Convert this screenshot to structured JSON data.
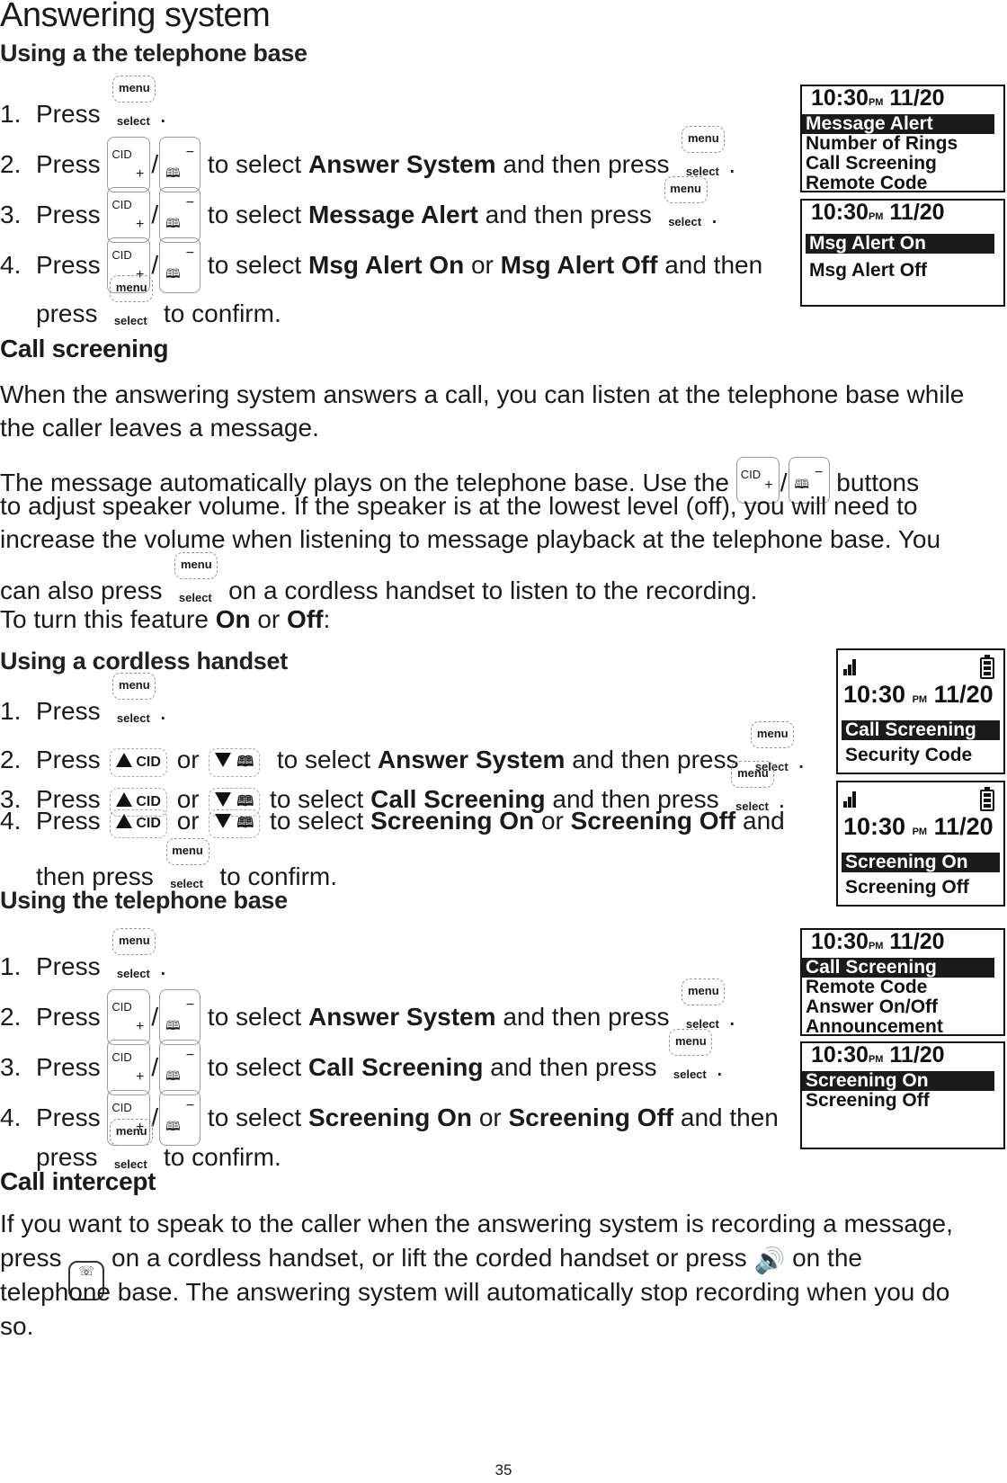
{
  "page": {
    "title": "Answering system",
    "page_number": "35"
  },
  "icons": {
    "menu_top": "menu",
    "menu_bottom": "select",
    "cid": "CID",
    "plus": "+",
    "minus": "−",
    "book": "🕮",
    "slash": "/",
    "or": "or",
    "talk": "☏",
    "speaker": "🔊"
  },
  "section1": {
    "heading": "Using a the telephone base",
    "steps": [
      {
        "num": "1.",
        "pre": "Press",
        "post": "."
      },
      {
        "num": "2.",
        "pre": "Press",
        "mid": "to select",
        "bold": "Answer System",
        "post": "and then press",
        "end": "."
      },
      {
        "num": "3.",
        "pre": "Press",
        "mid": "to select",
        "bold": "Message Alert",
        "post": "and then press",
        "end": "."
      },
      {
        "num": "4.",
        "pre": "Press",
        "mid": "to select",
        "bold": "Msg Alert On",
        "or": "or",
        "bold2": "Msg Alert Off",
        "post": "and then",
        "cont_pre": "press",
        "cont_post": "to confirm."
      }
    ],
    "screens": [
      {
        "time": "10:30",
        "ampm": "PM",
        "date": "11/20",
        "items": [
          "Message Alert",
          "Number of Rings",
          "Call Screening",
          "Remote Code"
        ],
        "selected": 0
      },
      {
        "time": "10:30",
        "ampm": "PM",
        "date": "11/20",
        "items": [
          "Msg Alert On",
          "Msg Alert Off"
        ],
        "selected": 0
      }
    ]
  },
  "call_screening": {
    "heading": "Call screening",
    "para1": "When the answering system answers a call, you can listen at the telephone base while the caller leaves a message.",
    "para2_a": "The message automatically plays on the telephone base. Use the",
    "para2_b": "buttons",
    "para2_c": "to adjust speaker volume. If the speaker is at the lowest level (off), you will need to",
    "para2_d": "increase the volume when listening to message playback at the telephone base. You",
    "para2_e": "can also press",
    "para2_f": "on a cordless handset to listen to the recording.",
    "toggle_a": "To turn this feature",
    "toggle_on": "On",
    "toggle_or": "or",
    "toggle_off": "Off",
    "toggle_end": ":"
  },
  "section2": {
    "heading": "Using a cordless handset",
    "steps": [
      {
        "num": "1.",
        "pre": "Press",
        "post": "."
      },
      {
        "num": "2.",
        "pre": "Press",
        "mid": "to select",
        "bold": "Answer System",
        "post": "and then press",
        "end": "."
      },
      {
        "num": "3.",
        "pre": "Press",
        "mid": "to select",
        "bold": "Call Screening",
        "post": "and then press",
        "end": "."
      },
      {
        "num": "4.",
        "pre": "Press",
        "mid": "to select",
        "bold": "Screening On",
        "or": "or",
        "bold2": "Screening Off",
        "post": "and",
        "cont_pre": "then press",
        "cont_post": "to confirm."
      }
    ],
    "screens": [
      {
        "time": "10:30",
        "ampm": "PM",
        "date": "11/20",
        "items": [
          "Call Screening",
          "Security Code"
        ],
        "selected": 0
      },
      {
        "time": "10:30",
        "ampm": "PM",
        "date": "11/20",
        "items": [
          "Screening On",
          "Screening Off"
        ],
        "selected": 0
      }
    ]
  },
  "section3": {
    "heading": "Using the telephone base",
    "steps": [
      {
        "num": "1.",
        "pre": "Press",
        "post": "."
      },
      {
        "num": "2.",
        "pre": "Press",
        "mid": "to select",
        "bold": "Answer System",
        "post": "and then press",
        "end": "."
      },
      {
        "num": "3.",
        "pre": "Press",
        "mid": "to select",
        "bold": "Call Screening",
        "post": "and then press",
        "end": "."
      },
      {
        "num": "4.",
        "pre": "Press",
        "mid": "to select",
        "bold": "Screening On",
        "or": "or",
        "bold2": "Screening Off",
        "post": "and then",
        "cont_pre": "press",
        "cont_post": "to confirm."
      }
    ],
    "screens": [
      {
        "time": "10:30",
        "ampm": "PM",
        "date": "11/20",
        "items": [
          "Call Screening",
          "Remote Code",
          "Answer On/Off",
          "Announcement"
        ],
        "selected": 0
      },
      {
        "time": "10:30",
        "ampm": "PM",
        "date": "11/20",
        "items": [
          "Screening On",
          "Screening Off"
        ],
        "selected": 0
      }
    ]
  },
  "call_intercept": {
    "heading": "Call intercept",
    "line1": "If you want to speak to the caller when the answering system is recording a message,",
    "line2_a": "press",
    "line2_b": "on a cordless handset, or lift the corded handset or press",
    "line2_c": "on the",
    "line3": "telephone base. The answering system will automatically stop recording when you do",
    "line4": "so."
  }
}
